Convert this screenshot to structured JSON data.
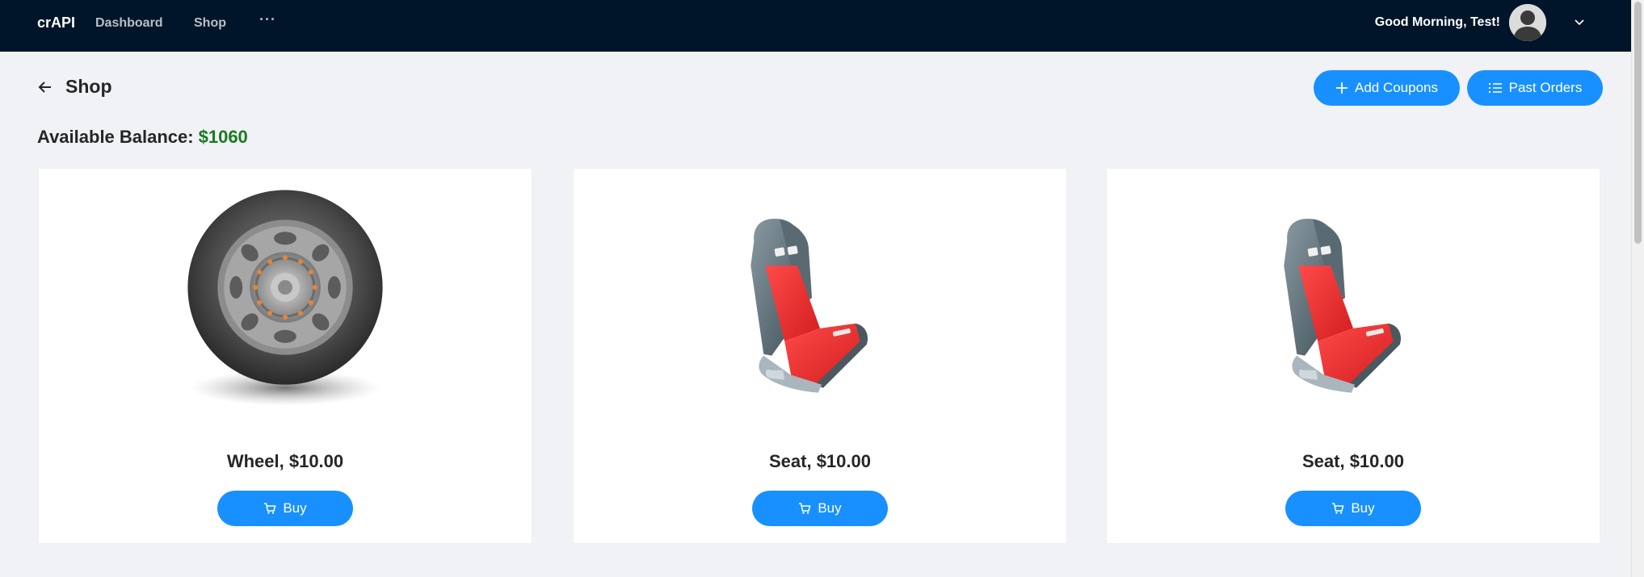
{
  "header": {
    "brand": "crAPI",
    "nav": [
      "Dashboard",
      "Shop",
      "···"
    ],
    "greeting": "Good Morning, Test!",
    "avatar_icon": "user-avatar-icon",
    "dropdown_icon": "chevron-down-icon",
    "bg_color": "#001529"
  },
  "page": {
    "title": "Shop",
    "back_icon": "arrow-left-icon",
    "add_coupons_label": "Add Coupons",
    "past_orders_label": "Past Orders",
    "balance_label": "Available Balance:",
    "balance_value": "$1060",
    "accent_color": "#1890ff",
    "balance_color": "#1b7a22"
  },
  "products": [
    {
      "title": "Wheel, $10.00",
      "image_icon": "wheel-image",
      "buy_label": "Buy"
    },
    {
      "title": "Seat, $10.00",
      "image_icon": "seat-image",
      "buy_label": "Buy"
    },
    {
      "title": "Seat, $10.00",
      "image_icon": "seat-image",
      "buy_label": "Buy"
    }
  ]
}
